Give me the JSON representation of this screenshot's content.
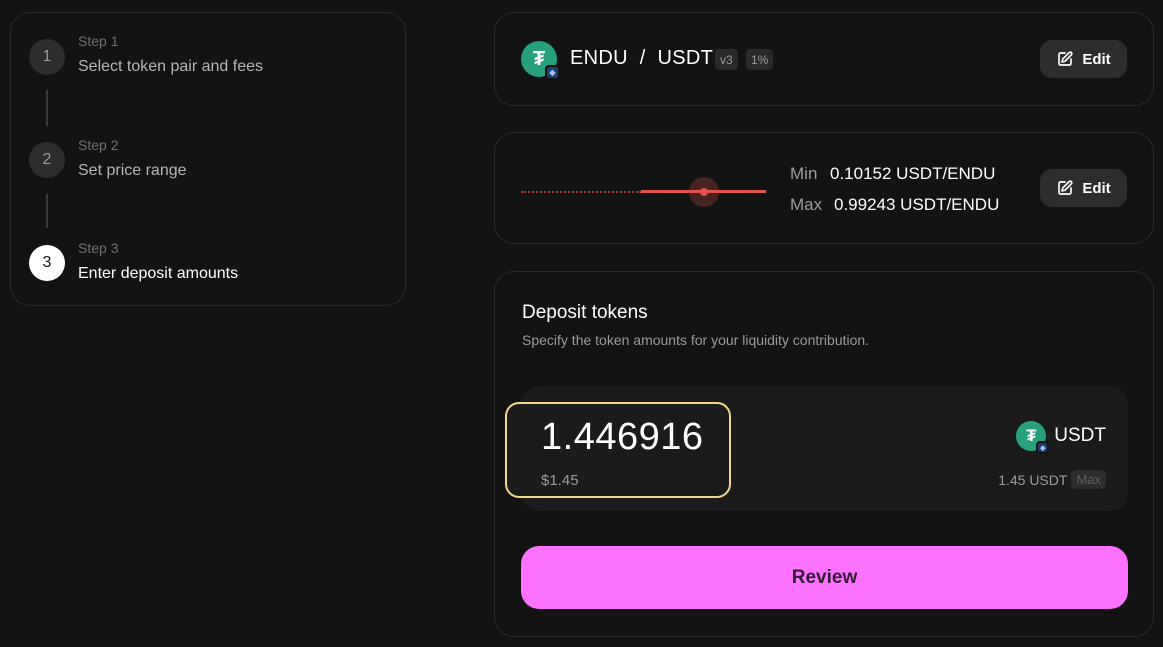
{
  "steps": [
    {
      "number": "1",
      "kicker": "Step 1",
      "title": "Select token pair and fees"
    },
    {
      "number": "2",
      "kicker": "Step 2",
      "title": "Set price range"
    },
    {
      "number": "3",
      "kicker": "Step 3",
      "title": "Enter deposit amounts"
    }
  ],
  "pair": {
    "token0": "ENDU",
    "separator": "/",
    "token1": "USDT",
    "version_tag": "v3",
    "fee_tag": "1%",
    "edit_label": "Edit",
    "logo_glyph": "₮"
  },
  "range": {
    "min_label": "Min",
    "min_value": "0.10152 USDT/ENDU",
    "max_label": "Max",
    "max_value": "0.99243 USDT/ENDU",
    "edit_label": "Edit"
  },
  "deposit": {
    "title": "Deposit tokens",
    "subtitle": "Specify the token amounts for your liquidity contribution.",
    "amount": "1.446916",
    "amount_usd": "$1.45",
    "token_symbol": "USDT",
    "balance": "1.45 USDT",
    "max_label": "Max",
    "review_label": "Review"
  },
  "colors": {
    "background": "#131313",
    "accent_pink": "#fc72ff",
    "focus_border": "#f2d78a",
    "range_red": "#e4534a",
    "usdt_green": "#26a17b"
  }
}
